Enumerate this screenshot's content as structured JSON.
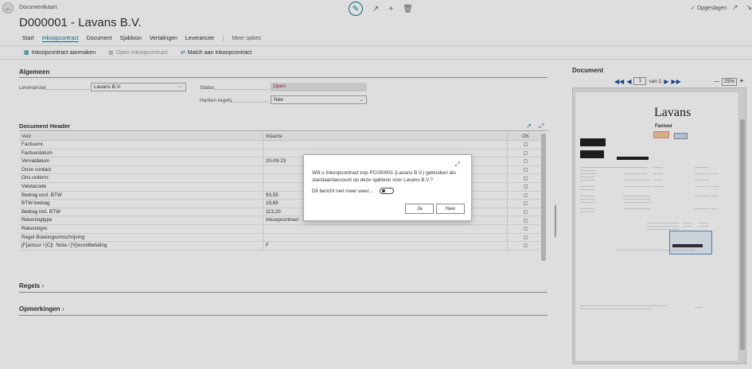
{
  "header": {
    "crumb": "Documentkaart",
    "title": "D000001 - Lavans B.V.",
    "saved": "Opgeslagen"
  },
  "tabs": [
    "Start",
    "Inkoopcontract",
    "Document",
    "Sjabloon",
    "Vertalingen",
    "Leverancier",
    "Meer opties"
  ],
  "toolbar": {
    "create": "Inkoopcontract aanmaken",
    "open": "Open Inkoopcontract",
    "match": "Match aan Inkoopcontract"
  },
  "general": {
    "title": "Algemeen",
    "vendor_label": "Leverancier",
    "vendor_value": "Lavans B.V.",
    "status_label": "Status",
    "status_value": "Open",
    "recognize_label": "Herken regels",
    "recognize_value": "Nee"
  },
  "docheader": {
    "title": "Document Header",
    "col_field": "Veld",
    "col_value": "Waarde",
    "col_ok": "OK",
    "rows": [
      {
        "field": "Factuurnr.",
        "value": ""
      },
      {
        "field": "Factuurdatum",
        "value": ""
      },
      {
        "field": "Vervaldatum",
        "value": "20-09-23"
      },
      {
        "field": "Onze contact",
        "value": ""
      },
      {
        "field": "Ons ordernr.",
        "value": ""
      },
      {
        "field": "Valutacode",
        "value": ""
      },
      {
        "field": "Bedrag excl. BTW",
        "value": "93,55"
      },
      {
        "field": "BTW-bedrag",
        "value": "19,65"
      },
      {
        "field": "Bedrag incl. BTW",
        "value": "113,20"
      },
      {
        "field": "Rekeningtype",
        "value": "Inkoopcontract"
      },
      {
        "field": "Rekeningnr.",
        "value": ""
      },
      {
        "field": "Regel Boekingsomschrijving",
        "value": ""
      },
      {
        "field": "[F]actuur / [C]r. Nota / [V]ooruitbetaling",
        "value": "F"
      }
    ]
  },
  "sections": {
    "lines": "Regels",
    "remarks": "Opmerkingen"
  },
  "document": {
    "title": "Document",
    "page_current": "1",
    "page_of": "van 1",
    "zoom": "25%",
    "brand": "Lavans",
    "doc_heading": "Factuur"
  },
  "modal": {
    "message": "Wilt u Inkoopcontract kop PC000001 (Lavans B.V.) gebruiken als standaardaccount op deze sjabloon voor Lavans B.V.?",
    "dont_show": "Dit bericht niet meer weer...",
    "yes": "Ja",
    "no": "Nee"
  },
  "colors": {
    "accent": "#0a7b8a",
    "status_red": "#b41e3c",
    "pager_blue": "#1e4f9a"
  }
}
